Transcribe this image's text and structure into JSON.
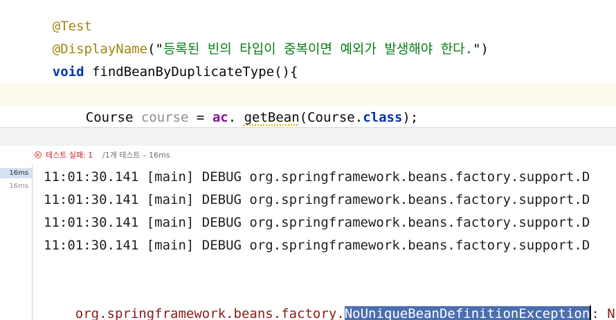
{
  "editor": {
    "line_annotation_test": "@Test",
    "display_name_annotation": "@DisplayName",
    "display_name_open": "(\"",
    "display_name_text": "등록된 빈의 타입이 중복이면 예외가 발생해야 한다.",
    "display_name_close": "\")",
    "method_keyword": "void",
    "method_signature": " findBeanByDuplicateType(){",
    "stmt_type": "Course ",
    "stmt_var": "course",
    "stmt_assign": " = ",
    "stmt_field": "ac",
    "stmt_dot": ". ",
    "stmt_method": "getBean",
    "stmt_arg_open": "(Course.",
    "stmt_class_kw": "class",
    "stmt_arg_close": ");",
    "closing_brace": "}"
  },
  "test_status": {
    "fail_label": "테스트 실패: 1",
    "count_label": " /1개 테스트 – 16ms"
  },
  "test_tree": {
    "durations": [
      "16ms",
      "16ms"
    ]
  },
  "console": {
    "log_lines": [
      "11:01:30.141 [main] DEBUG org.springframework.beans.factory.support.D",
      "11:01:30.141 [main] DEBUG org.springframework.beans.factory.support.D",
      "11:01:30.141 [main] DEBUG org.springframework.beans.factory.support.D",
      "11:01:30.141 [main] DEBUG org.springframework.beans.factory.support.D"
    ],
    "exception_prefix": "org.springframework.beans.factory.",
    "exception_name": "NoUniqueBeanDefinitionException",
    "exception_suffix": ": No"
  },
  "colors": {
    "annotation": "#9e880d",
    "string": "#067d17",
    "keyword": "#0033b3",
    "field": "#871094",
    "failure": "#c7222d",
    "selection": "#4b6eaf"
  }
}
